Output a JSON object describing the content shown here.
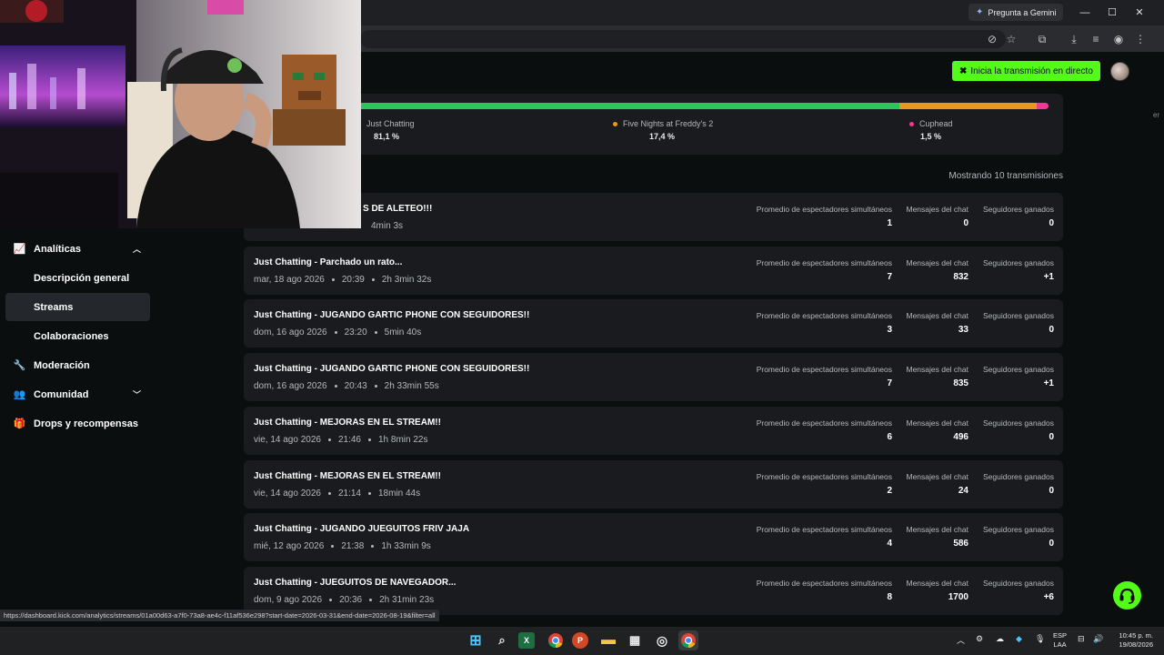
{
  "browser": {
    "gemini_label": "Pregunta a Gemini",
    "status_url": "https://dashboard.kick.com/analytics/streams/01a00d63-a7f0-73a8-ae4c-f11af536e298?start-date=2026-03-31&end-date=2026-08-19&filter=all"
  },
  "header": {
    "go_live_label": "Inicia la transmisión en directo"
  },
  "categories": [
    {
      "name": "Just Chatting",
      "pct": "81,1 %",
      "color": "#2fc35c"
    },
    {
      "name": "Five Nights at Freddy's 2",
      "pct": "17,4 %",
      "color": "#e79a1a"
    },
    {
      "name": "Cuphead",
      "pct": "1,5 %",
      "color": "#f13897"
    }
  ],
  "showing_label": "Mostrando 10 transmisiones",
  "sidebar": {
    "analytics": "Analíticas",
    "overview": "Descripción general",
    "streams": "Streams",
    "collabs": "Colaboraciones",
    "moderation": "Moderación",
    "community": "Comunidad",
    "drops": "Drops y recompensas"
  },
  "columns": {
    "viewers": "Promedio de espectadores simultáneos",
    "messages": "Mensajes del chat",
    "followers": "Seguidores ganados"
  },
  "streams": [
    {
      "title": "S DE ALETEO!!!",
      "date": "",
      "time": "",
      "duration": "4min 3s",
      "viewers": "1",
      "messages": "0",
      "followers": "0"
    },
    {
      "title": "Just Chatting - Parchado un rato...",
      "date": "mar, 18 ago 2026",
      "time": "20:39",
      "duration": "2h 3min 32s",
      "viewers": "7",
      "messages": "832",
      "followers": "+1"
    },
    {
      "title": "Just Chatting - JUGANDO GARTIC PHONE CON SEGUIDORES!!",
      "date": "dom, 16 ago 2026",
      "time": "23:20",
      "duration": "5min 40s",
      "viewers": "3",
      "messages": "33",
      "followers": "0"
    },
    {
      "title": "Just Chatting - JUGANDO GARTIC PHONE CON SEGUIDORES!!",
      "date": "dom, 16 ago 2026",
      "time": "20:43",
      "duration": "2h 33min 55s",
      "viewers": "7",
      "messages": "835",
      "followers": "+1"
    },
    {
      "title": "Just Chatting - MEJORAS EN EL STREAM!!",
      "date": "vie, 14 ago 2026",
      "time": "21:46",
      "duration": "1h 8min 22s",
      "viewers": "6",
      "messages": "496",
      "followers": "0"
    },
    {
      "title": "Just Chatting - MEJORAS EN EL STREAM!!",
      "date": "vie, 14 ago 2026",
      "time": "21:14",
      "duration": "18min 44s",
      "viewers": "2",
      "messages": "24",
      "followers": "0"
    },
    {
      "title": "Just Chatting - JUGANDO JUEGUITOS FRIV JAJA",
      "date": "mié, 12 ago 2026",
      "time": "21:38",
      "duration": "1h 33min 9s",
      "viewers": "4",
      "messages": "586",
      "followers": "0"
    },
    {
      "title": "Just Chatting - JUEGUITOS DE NAVEGADOR...",
      "date": "dom, 9 ago 2026",
      "time": "20:36",
      "duration": "2h 31min 23s",
      "viewers": "8",
      "messages": "1700",
      "followers": "+6"
    }
  ],
  "taskbar": {
    "lang_1": "ESP",
    "lang_2": "LAA",
    "time": "10:45 p. m.",
    "date": "19/08/2026"
  },
  "edge_char": "er"
}
